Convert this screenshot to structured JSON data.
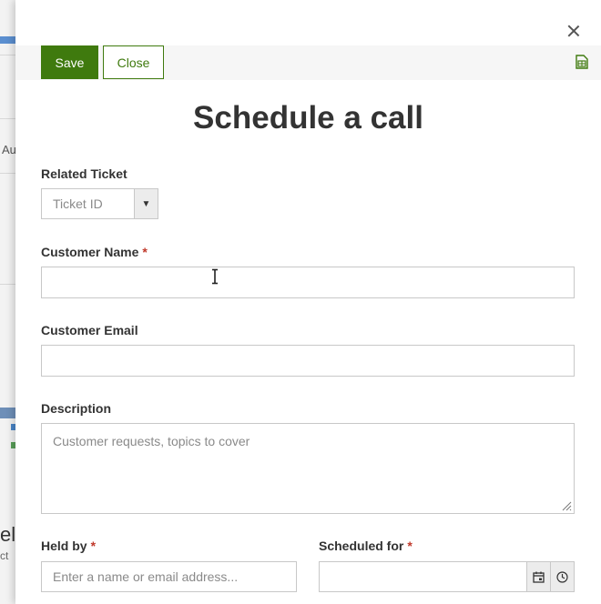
{
  "background_app": {
    "fragment_1": "Au",
    "fragment_2": "elo",
    "fragment_3": "ct"
  },
  "toolbar": {
    "save_label": "Save",
    "close_label": "Close",
    "export_icon": "excel-icon"
  },
  "dialog": {
    "close_icon": "close-icon",
    "title": "Schedule a call"
  },
  "form": {
    "related_ticket": {
      "label": "Related Ticket",
      "placeholder": "Ticket ID"
    },
    "customer_name": {
      "label": "Customer Name",
      "required_mark": "*",
      "value": ""
    },
    "customer_email": {
      "label": "Customer Email",
      "value": ""
    },
    "description": {
      "label": "Description",
      "placeholder": "Customer requests, topics to cover"
    },
    "held_by": {
      "label": "Held by",
      "required_mark": "*",
      "placeholder": "Enter a name or email address..."
    },
    "scheduled_for": {
      "label": "Scheduled for",
      "required_mark": "*",
      "value": "",
      "calendar_icon": "calendar-icon",
      "clock_icon": "clock-icon"
    }
  },
  "colors": {
    "accent": "#3f7a0e",
    "required": "#c0392b",
    "border": "#c8c8c8"
  }
}
